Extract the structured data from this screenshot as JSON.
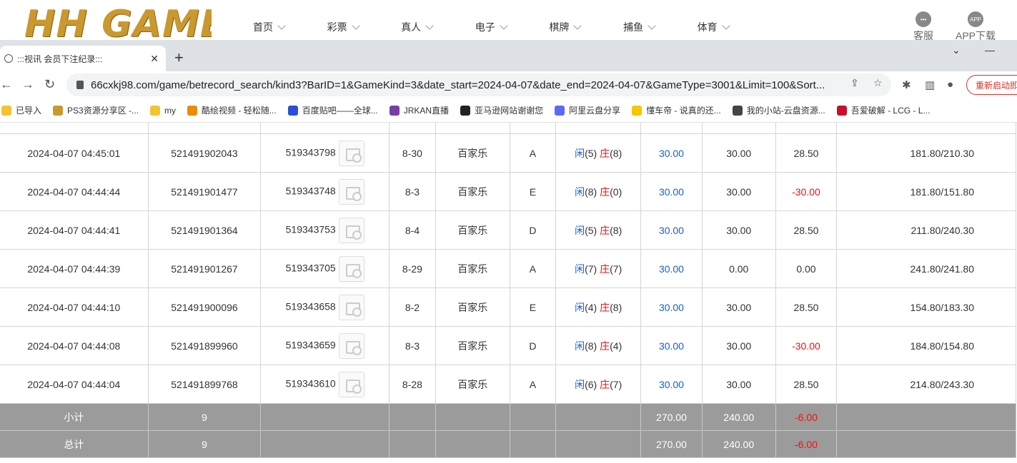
{
  "site": {
    "logo": "HH GAME",
    "nav": [
      "首页",
      "彩票",
      "真人",
      "电子",
      "棋牌",
      "捕鱼",
      "体育"
    ],
    "service_label": "客服",
    "app_label": "APP下载",
    "app_icon_text": "APP"
  },
  "browser": {
    "tab_title": ":::视讯 会员下注纪录:::",
    "new_tab": "+",
    "url": "66cxkj98.com/game/betrecord_search/kind3?BarID=1&GameKind=3&date_start=2024-04-07&date_end=2024-04-07&GameType=3001&Limit=100&Sort...",
    "restart_label": "重新启动即可",
    "bookmarks": [
      {
        "label": "已导入",
        "color": "#f4c430"
      },
      {
        "label": "PS3资源分享区 -...",
        "color": "#c89a2a"
      },
      {
        "label": "my",
        "color": "#f4c430"
      },
      {
        "label": "酷绘视频 - 轻松随...",
        "color": "#f08a00"
      },
      {
        "label": "百度贴吧——全球...",
        "color": "#2b50d8"
      },
      {
        "label": "JRKAN直播",
        "color": "#7a3da8"
      },
      {
        "label": "亚马逊网站谢谢您",
        "color": "#222222"
      },
      {
        "label": "阿里云盘分享",
        "color": "#5b6cf0"
      },
      {
        "label": "懂车帝 - 说真的还...",
        "color": "#f7c600"
      },
      {
        "label": "我的小站-云盘资源...",
        "color": "#444444"
      },
      {
        "label": "吾爱破解 - LCG - L...",
        "color": "#c8102e"
      }
    ]
  },
  "rows": [
    {
      "time": "2024-04-07 04:45:01",
      "id": "521491902043",
      "round": "519343798",
      "table": "8-30",
      "game": "百家乐",
      "tablecode": "A",
      "p": "(5)",
      "b": "(8)",
      "bet": "30.00",
      "valid": "30.00",
      "win": "28.50",
      "win_neg": false,
      "balance": "181.80/210.30"
    },
    {
      "time": "2024-04-07 04:44:44",
      "id": "521491901477",
      "round": "519343748",
      "table": "8-3",
      "game": "百家乐",
      "tablecode": "E",
      "p": "(8)",
      "b": "(0)",
      "bet": "30.00",
      "valid": "30.00",
      "win": "-30.00",
      "win_neg": true,
      "balance": "181.80/151.80"
    },
    {
      "time": "2024-04-07 04:44:41",
      "id": "521491901364",
      "round": "519343753",
      "table": "8-4",
      "game": "百家乐",
      "tablecode": "D",
      "p": "(5)",
      "b": "(8)",
      "bet": "30.00",
      "valid": "30.00",
      "win": "28.50",
      "win_neg": false,
      "balance": "211.80/240.30"
    },
    {
      "time": "2024-04-07 04:44:39",
      "id": "521491901267",
      "round": "519343705",
      "table": "8-29",
      "game": "百家乐",
      "tablecode": "A",
      "p": "(7)",
      "b": "(7)",
      "bet": "30.00",
      "valid": "0.00",
      "win": "0.00",
      "win_neg": false,
      "balance": "241.80/241.80"
    },
    {
      "time": "2024-04-07 04:44:10",
      "id": "521491900096",
      "round": "519343658",
      "table": "8-2",
      "game": "百家乐",
      "tablecode": "E",
      "p": "(4)",
      "b": "(8)",
      "bet": "30.00",
      "valid": "30.00",
      "win": "28.50",
      "win_neg": false,
      "balance": "154.80/183.30"
    },
    {
      "time": "2024-04-07 04:44:08",
      "id": "521491899960",
      "round": "519343659",
      "table": "8-3",
      "game": "百家乐",
      "tablecode": "D",
      "p": "(8)",
      "b": "(4)",
      "bet": "30.00",
      "valid": "30.00",
      "win": "-30.00",
      "win_neg": true,
      "balance": "184.80/154.80"
    },
    {
      "time": "2024-04-07 04:44:04",
      "id": "521491899768",
      "round": "519343610",
      "table": "8-28",
      "game": "百家乐",
      "tablecode": "A",
      "p": "(6)",
      "b": "(7)",
      "bet": "30.00",
      "valid": "30.00",
      "win": "28.50",
      "win_neg": false,
      "balance": "214.80/243.30"
    }
  ],
  "player_label": "闲",
  "banker_label": "庄",
  "subtotal": {
    "label": "小计",
    "count": "9",
    "bet": "270.00",
    "valid": "240.00",
    "win": "-6.00"
  },
  "total": {
    "label": "总计",
    "count": "9",
    "bet": "270.00",
    "valid": "240.00",
    "win": "-6.00"
  }
}
